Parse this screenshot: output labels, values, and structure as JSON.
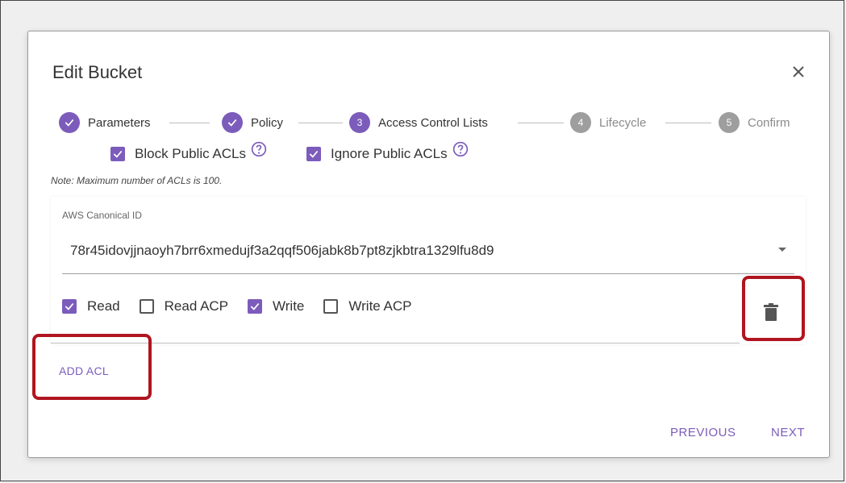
{
  "dialog": {
    "title": "Edit Bucket"
  },
  "stepper": {
    "steps": [
      {
        "label": "Parameters",
        "marker": "check",
        "state": "complete"
      },
      {
        "label": "Policy",
        "marker": "check",
        "state": "complete"
      },
      {
        "label": "Access Control Lists",
        "marker": "3",
        "state": "active"
      },
      {
        "label": "Lifecycle",
        "marker": "4",
        "state": "pending"
      },
      {
        "label": "Confirm",
        "marker": "5",
        "state": "pending"
      }
    ]
  },
  "public_acls": {
    "block": {
      "label": "Block Public ACLs",
      "checked": true
    },
    "ignore": {
      "label": "Ignore Public ACLs",
      "checked": true
    }
  },
  "note": "Note: Maximum number of ACLs is 100.",
  "acl": {
    "id_label": "AWS Canonical ID",
    "id_value": "78r45idovjjnaoyh7brr6xmedujf3a2qqf506jabk8b7pt8zjkbtra1329lfu8d9",
    "permissions": [
      {
        "label": "Read",
        "checked": true
      },
      {
        "label": "Read ACP",
        "checked": false
      },
      {
        "label": "Write",
        "checked": true
      },
      {
        "label": "Write ACP",
        "checked": false
      }
    ]
  },
  "actions": {
    "add_acl": "ADD ACL",
    "previous": "PREVIOUS",
    "next": "NEXT"
  },
  "colors": {
    "accent": "#7c5cbb",
    "highlight": "#b01520",
    "pending": "#9e9e9e"
  },
  "icons": {
    "close": "close-icon",
    "check": "check-icon",
    "help": "help-circle-icon",
    "delete": "trash-icon",
    "dropdown": "dropdown-arrow-icon"
  }
}
